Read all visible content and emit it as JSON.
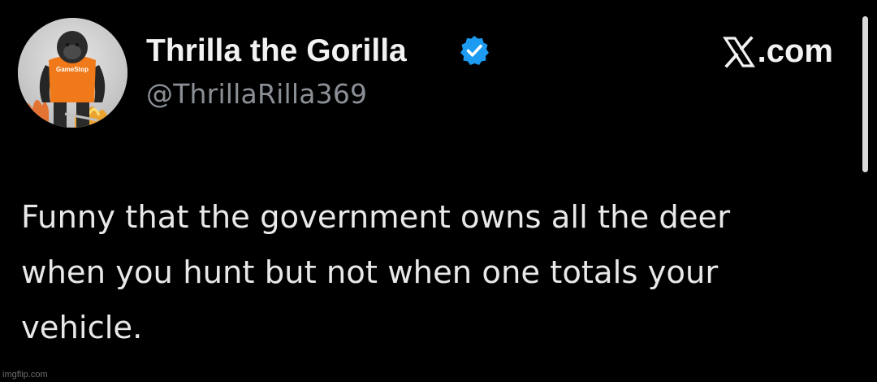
{
  "tweet": {
    "author": {
      "display_name": "Thrilla the Gorilla",
      "handle": "@ThrillaRilla369",
      "verified": true,
      "avatar_shirt_text": "GameStop"
    },
    "text_lines": [
      "Funny that the government owns all the deer",
      "when you hunt but not when one totals your",
      "vehicle."
    ]
  },
  "brand": {
    "text": ".com",
    "icon": "x-logo-icon"
  },
  "watermark": "imgflip.com",
  "colors": {
    "background": "#000000",
    "name": "#f2f2f2",
    "handle": "#8b9096",
    "body": "#e8e8e8",
    "verified": "#1d9bf0",
    "shirt": "#f07a1a"
  }
}
